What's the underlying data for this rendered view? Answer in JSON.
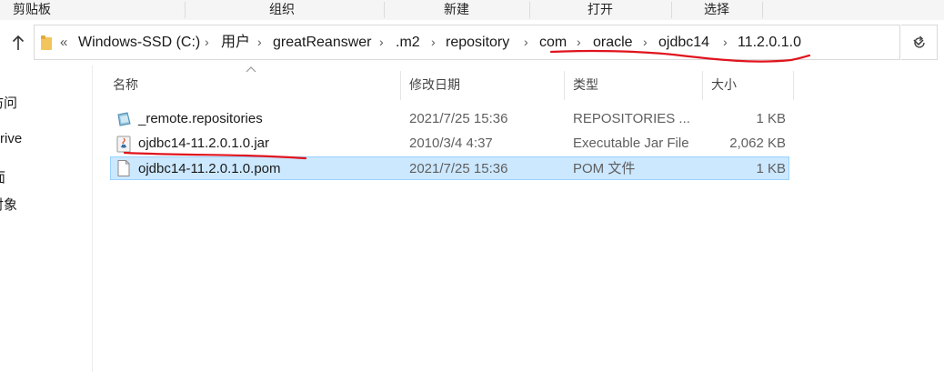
{
  "ribbon": {
    "groups": [
      "剪贴板",
      "组织",
      "新建",
      "打开",
      "选择"
    ]
  },
  "address_bar": {
    "crumbs": [
      "Windows-SSD (C:)",
      "用户",
      "greatReanswer",
      ".m2",
      "repository",
      "com",
      "oracle",
      "ojdbc14",
      "11.2.0.1.0"
    ],
    "overflow_glyph": "«"
  },
  "nav_pane": {
    "items": [
      "访问",
      "rive",
      "面",
      "对象"
    ]
  },
  "columns": {
    "name": "名称",
    "date": "修改日期",
    "type": "类型",
    "size": "大小"
  },
  "files": [
    {
      "icon": "repositories-file-icon",
      "name": "_remote.repositories",
      "date": "2021/7/25 15:36",
      "type": "REPOSITORIES ...",
      "size": "1 KB",
      "selected": false
    },
    {
      "icon": "jar-file-icon",
      "name": "ojdbc14-11.2.0.1.0.jar",
      "date": "2010/3/4 4:37",
      "type": "Executable Jar File",
      "size": "2,062 KB",
      "selected": false
    },
    {
      "icon": "pom-file-icon",
      "name": "ojdbc14-11.2.0.1.0.pom",
      "date": "2021/7/25 15:36",
      "type": "POM 文件",
      "size": "1 KB",
      "selected": true
    }
  ],
  "colors": {
    "selection_bg": "#cce8ff",
    "selection_border": "#99d1ff",
    "annotation_red": "#e0141e",
    "folder_yellow": "#f2c55c"
  }
}
